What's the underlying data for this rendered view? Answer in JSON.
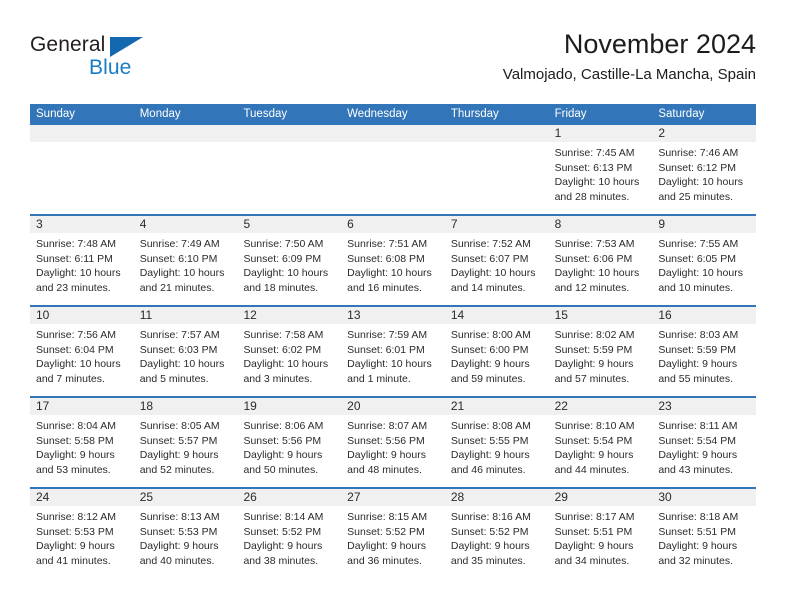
{
  "logo": {
    "word1": "General",
    "word2": "Blue",
    "triangle_color": "#1368b0",
    "word2_color": "#1a7cc4"
  },
  "header": {
    "title": "November 2024",
    "subtitle": "Valmojado, Castille-La Mancha, Spain"
  },
  "theme": {
    "header_blue": "#3275b8",
    "daynum_band": "#f0f0f0",
    "text": "#2b2b2b"
  },
  "calendar": {
    "weekday_headers": [
      "Sunday",
      "Monday",
      "Tuesday",
      "Wednesday",
      "Thursday",
      "Friday",
      "Saturday"
    ],
    "weeks": [
      [
        {
          "day": "",
          "sunrise": "",
          "sunset": "",
          "daylight": ""
        },
        {
          "day": "",
          "sunrise": "",
          "sunset": "",
          "daylight": ""
        },
        {
          "day": "",
          "sunrise": "",
          "sunset": "",
          "daylight": ""
        },
        {
          "day": "",
          "sunrise": "",
          "sunset": "",
          "daylight": ""
        },
        {
          "day": "",
          "sunrise": "",
          "sunset": "",
          "daylight": ""
        },
        {
          "day": "1",
          "sunrise": "Sunrise: 7:45 AM",
          "sunset": "Sunset: 6:13 PM",
          "daylight": "Daylight: 10 hours and 28 minutes."
        },
        {
          "day": "2",
          "sunrise": "Sunrise: 7:46 AM",
          "sunset": "Sunset: 6:12 PM",
          "daylight": "Daylight: 10 hours and 25 minutes."
        }
      ],
      [
        {
          "day": "3",
          "sunrise": "Sunrise: 7:48 AM",
          "sunset": "Sunset: 6:11 PM",
          "daylight": "Daylight: 10 hours and 23 minutes."
        },
        {
          "day": "4",
          "sunrise": "Sunrise: 7:49 AM",
          "sunset": "Sunset: 6:10 PM",
          "daylight": "Daylight: 10 hours and 21 minutes."
        },
        {
          "day": "5",
          "sunrise": "Sunrise: 7:50 AM",
          "sunset": "Sunset: 6:09 PM",
          "daylight": "Daylight: 10 hours and 18 minutes."
        },
        {
          "day": "6",
          "sunrise": "Sunrise: 7:51 AM",
          "sunset": "Sunset: 6:08 PM",
          "daylight": "Daylight: 10 hours and 16 minutes."
        },
        {
          "day": "7",
          "sunrise": "Sunrise: 7:52 AM",
          "sunset": "Sunset: 6:07 PM",
          "daylight": "Daylight: 10 hours and 14 minutes."
        },
        {
          "day": "8",
          "sunrise": "Sunrise: 7:53 AM",
          "sunset": "Sunset: 6:06 PM",
          "daylight": "Daylight: 10 hours and 12 minutes."
        },
        {
          "day": "9",
          "sunrise": "Sunrise: 7:55 AM",
          "sunset": "Sunset: 6:05 PM",
          "daylight": "Daylight: 10 hours and 10 minutes."
        }
      ],
      [
        {
          "day": "10",
          "sunrise": "Sunrise: 7:56 AM",
          "sunset": "Sunset: 6:04 PM",
          "daylight": "Daylight: 10 hours and 7 minutes."
        },
        {
          "day": "11",
          "sunrise": "Sunrise: 7:57 AM",
          "sunset": "Sunset: 6:03 PM",
          "daylight": "Daylight: 10 hours and 5 minutes."
        },
        {
          "day": "12",
          "sunrise": "Sunrise: 7:58 AM",
          "sunset": "Sunset: 6:02 PM",
          "daylight": "Daylight: 10 hours and 3 minutes."
        },
        {
          "day": "13",
          "sunrise": "Sunrise: 7:59 AM",
          "sunset": "Sunset: 6:01 PM",
          "daylight": "Daylight: 10 hours and 1 minute."
        },
        {
          "day": "14",
          "sunrise": "Sunrise: 8:00 AM",
          "sunset": "Sunset: 6:00 PM",
          "daylight": "Daylight: 9 hours and 59 minutes."
        },
        {
          "day": "15",
          "sunrise": "Sunrise: 8:02 AM",
          "sunset": "Sunset: 5:59 PM",
          "daylight": "Daylight: 9 hours and 57 minutes."
        },
        {
          "day": "16",
          "sunrise": "Sunrise: 8:03 AM",
          "sunset": "Sunset: 5:59 PM",
          "daylight": "Daylight: 9 hours and 55 minutes."
        }
      ],
      [
        {
          "day": "17",
          "sunrise": "Sunrise: 8:04 AM",
          "sunset": "Sunset: 5:58 PM",
          "daylight": "Daylight: 9 hours and 53 minutes."
        },
        {
          "day": "18",
          "sunrise": "Sunrise: 8:05 AM",
          "sunset": "Sunset: 5:57 PM",
          "daylight": "Daylight: 9 hours and 52 minutes."
        },
        {
          "day": "19",
          "sunrise": "Sunrise: 8:06 AM",
          "sunset": "Sunset: 5:56 PM",
          "daylight": "Daylight: 9 hours and 50 minutes."
        },
        {
          "day": "20",
          "sunrise": "Sunrise: 8:07 AM",
          "sunset": "Sunset: 5:56 PM",
          "daylight": "Daylight: 9 hours and 48 minutes."
        },
        {
          "day": "21",
          "sunrise": "Sunrise: 8:08 AM",
          "sunset": "Sunset: 5:55 PM",
          "daylight": "Daylight: 9 hours and 46 minutes."
        },
        {
          "day": "22",
          "sunrise": "Sunrise: 8:10 AM",
          "sunset": "Sunset: 5:54 PM",
          "daylight": "Daylight: 9 hours and 44 minutes."
        },
        {
          "day": "23",
          "sunrise": "Sunrise: 8:11 AM",
          "sunset": "Sunset: 5:54 PM",
          "daylight": "Daylight: 9 hours and 43 minutes."
        }
      ],
      [
        {
          "day": "24",
          "sunrise": "Sunrise: 8:12 AM",
          "sunset": "Sunset: 5:53 PM",
          "daylight": "Daylight: 9 hours and 41 minutes."
        },
        {
          "day": "25",
          "sunrise": "Sunrise: 8:13 AM",
          "sunset": "Sunset: 5:53 PM",
          "daylight": "Daylight: 9 hours and 40 minutes."
        },
        {
          "day": "26",
          "sunrise": "Sunrise: 8:14 AM",
          "sunset": "Sunset: 5:52 PM",
          "daylight": "Daylight: 9 hours and 38 minutes."
        },
        {
          "day": "27",
          "sunrise": "Sunrise: 8:15 AM",
          "sunset": "Sunset: 5:52 PM",
          "daylight": "Daylight: 9 hours and 36 minutes."
        },
        {
          "day": "28",
          "sunrise": "Sunrise: 8:16 AM",
          "sunset": "Sunset: 5:52 PM",
          "daylight": "Daylight: 9 hours and 35 minutes."
        },
        {
          "day": "29",
          "sunrise": "Sunrise: 8:17 AM",
          "sunset": "Sunset: 5:51 PM",
          "daylight": "Daylight: 9 hours and 34 minutes."
        },
        {
          "day": "30",
          "sunrise": "Sunrise: 8:18 AM",
          "sunset": "Sunset: 5:51 PM",
          "daylight": "Daylight: 9 hours and 32 minutes."
        }
      ]
    ]
  }
}
